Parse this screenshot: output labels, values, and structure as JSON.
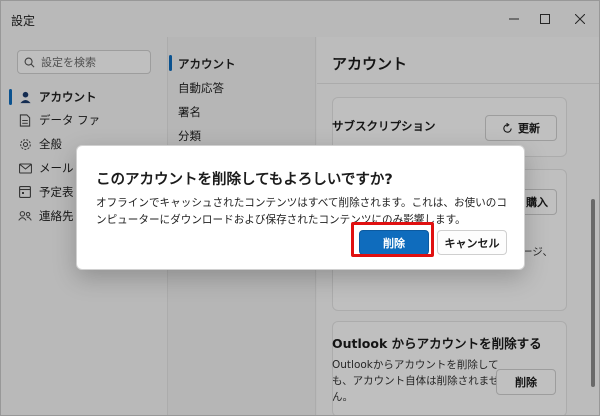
{
  "window": {
    "title": "設定"
  },
  "sidebar": {
    "search_placeholder": "設定を検索",
    "items": [
      {
        "label": "アカウント",
        "icon": "person-icon"
      },
      {
        "label": "データ ファ",
        "icon": "document-icon"
      },
      {
        "label": "全般",
        "icon": "gear-icon"
      },
      {
        "label": "メール",
        "icon": "mail-icon"
      },
      {
        "label": "予定表",
        "icon": "calendar-icon"
      },
      {
        "label": "連絡先",
        "icon": "people-icon"
      }
    ]
  },
  "subnav": {
    "items": [
      {
        "label": "アカウント"
      },
      {
        "label": "自動応答"
      },
      {
        "label": "署名"
      },
      {
        "label": "分類"
      }
    ]
  },
  "content": {
    "title": "アカウント",
    "subscription_label": "サブスクリプション",
    "update_button": "更新",
    "purchase_button": "購入",
    "fragment_text": "ージ、",
    "remove_heading": "Outlook からアカウントを削除する",
    "remove_description": "Outlookからアカウントを削除しても、アカウント自体は削除されません。",
    "remove_button": "削除"
  },
  "dialog": {
    "title": "このアカウントを削除してもよろしいですか?",
    "body": "オフラインでキャッシュされたコンテンツはすべて削除されます。これは、お使いのコンピューターにダウンロードおよび保存されたコンテンツにのみ影響します。",
    "delete_button": "削除",
    "cancel_button": "キャンセル"
  },
  "colors": {
    "accent": "#0f6cbd",
    "highlight": "#e01010"
  }
}
